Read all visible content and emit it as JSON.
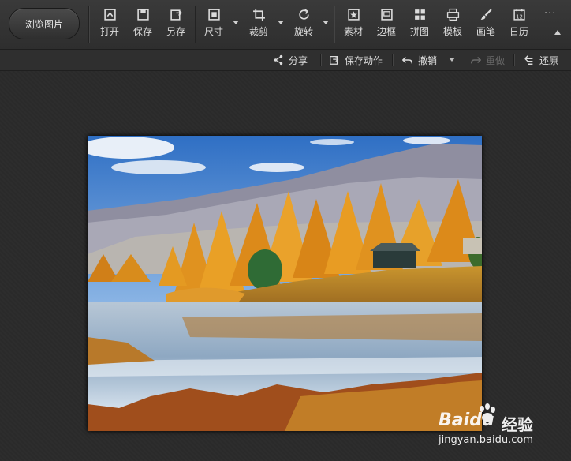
{
  "toolbar": {
    "browse_label": "浏览图片",
    "tools": [
      {
        "label": "打开",
        "icon": "open-icon"
      },
      {
        "label": "保存",
        "icon": "save-icon"
      },
      {
        "label": "另存",
        "icon": "save-as-icon"
      },
      {
        "label": "尺寸",
        "icon": "resize-icon"
      },
      {
        "label": "裁剪",
        "icon": "crop-icon"
      },
      {
        "label": "旋转",
        "icon": "rotate-icon"
      },
      {
        "label": "素材",
        "icon": "material-icon"
      },
      {
        "label": "边框",
        "icon": "border-icon"
      },
      {
        "label": "拼图",
        "icon": "collage-icon"
      },
      {
        "label": "模板",
        "icon": "template-icon"
      },
      {
        "label": "画笔",
        "icon": "brush-icon"
      },
      {
        "label": "日历",
        "icon": "calendar-icon"
      }
    ],
    "calendar_day": "12",
    "more_label": "···"
  },
  "subbar": {
    "share_label": "分享",
    "save_action_label": "保存动作",
    "undo_label": "撤销",
    "redo_label": "重做",
    "restore_label": "还原"
  },
  "watermark": {
    "brand": "Bai",
    "brand_suffix": "du",
    "cn": "经验",
    "url": "jingyan.baidu.com"
  },
  "colors": {
    "toolbar_bg": "#333333",
    "icon": "#dcdcdc",
    "disabled": "#6a6a6a"
  }
}
